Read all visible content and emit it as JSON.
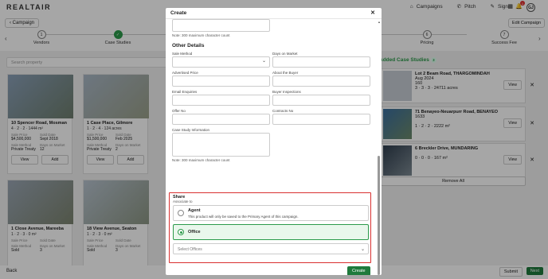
{
  "app": {
    "logo": "REALTAIR"
  },
  "nav": {
    "campaigns": "Campaigns",
    "pitch": "Pitch",
    "sign": "Sign",
    "notif_count": "1",
    "avatar": "GJ"
  },
  "subheader": {
    "campaign_btn": "Campaign",
    "edit_campaign": "Edit Campaign"
  },
  "steps": [
    {
      "num": "1",
      "label": "Vendors"
    },
    {
      "num": "✓",
      "label": "Case Studies"
    },
    {
      "num": "6",
      "label": "Pricing"
    },
    {
      "num": "7",
      "label": "Success Fee"
    }
  ],
  "search": {
    "placeholder": "Search property"
  },
  "cards": [
    {
      "title": "10 Spencer Road, Mosman",
      "feat": "4 · 2 · 2 · 1444 m²",
      "l1": "Sale Price",
      "l2": "Sold Date",
      "v1": "$4,500,000",
      "v2": "Sept 2018",
      "l3": "Sale Method",
      "l4": "Days on Market",
      "v3": "Private Treaty",
      "v4": "12",
      "view": "View",
      "add": "Add"
    },
    {
      "title": "1 Case Place, Gilmore",
      "feat": "1 · 2 · 4 · 124 acres",
      "l1": "Sale Price",
      "l2": "Sold Date",
      "v1": "$1,500,000",
      "v2": "Feb 2025",
      "l3": "Sale Method",
      "l4": "Days on Market",
      "v3": "Private Treaty",
      "v4": "2",
      "view": "View",
      "add": "Add"
    },
    {
      "title": "1 Close Avenue, Mareeba",
      "feat": "1 · 2 · 3 · 0 m²",
      "l1": "Sale Price",
      "l2": "Sold Date",
      "v1": "",
      "v2": "",
      "l3": "Sale Method",
      "l4": "Days on Market",
      "v3": "Sold",
      "v4": "3",
      "view": "View",
      "add": "Add"
    },
    {
      "title": "18 View Avenue, Seaton",
      "feat": "1 · 2 · 3 · 0 m²",
      "l1": "Sale Price",
      "l2": "Sold Date",
      "v1": "$310,000",
      "v2": "Sept 2013",
      "l3": "Sale Method",
      "l4": "Days on Market",
      "v3": "Sold",
      "v4": "3",
      "view": "View",
      "add": "Add"
    }
  ],
  "right": {
    "title": "Added Case Studies",
    "count": "3",
    "items": [
      {
        "title": "Lot 2 Beam Road, THARGOMINDAH",
        "line2": "Aug 2024",
        "line3": "160",
        "feat": "3 · 3 · 3 · 24711 acres",
        "view": "View"
      },
      {
        "title": "71 Benayeo-Neuarpurr Road, BENAYEO",
        "line2": "1633",
        "line3": "",
        "feat": "1 · 2 · 2 · 2222 m²",
        "view": "View"
      },
      {
        "title": "6 Breckler Drive, MUNDARING",
        "line2": "",
        "line3": "",
        "feat": "0 · 0 · 0 · 167 m²",
        "view": "View"
      }
    ],
    "remove_all": "Remove All"
  },
  "bottom": {
    "back": "Back",
    "submit": "Submit",
    "next": "Next"
  },
  "modal": {
    "title": "Create",
    "note_top": "Note: 300 maximum character count",
    "other_details": "Other Details",
    "fields": {
      "sale_method": "Sale Method",
      "days_on_market": "Days on Market",
      "advertised_price": "Advertised Price",
      "about_buyer": "About the Buyer",
      "email_enquiries": "Email Enquiries",
      "buyer_inspections": "Buyer Inspections",
      "offer_no": "Offer No",
      "contracts_no": "Contracts No",
      "case_study_info": "Case Study Information"
    },
    "note_bottom": "Note: 300 maximum character count",
    "share": {
      "title": "Share",
      "subtitle": "Associate to",
      "agent_title": "Agent",
      "agent_desc": "This product will only be saved to the Primary Agent of this campaign.",
      "office_title": "Office",
      "select_placeholder": "Select Offices"
    },
    "create": "Create"
  }
}
